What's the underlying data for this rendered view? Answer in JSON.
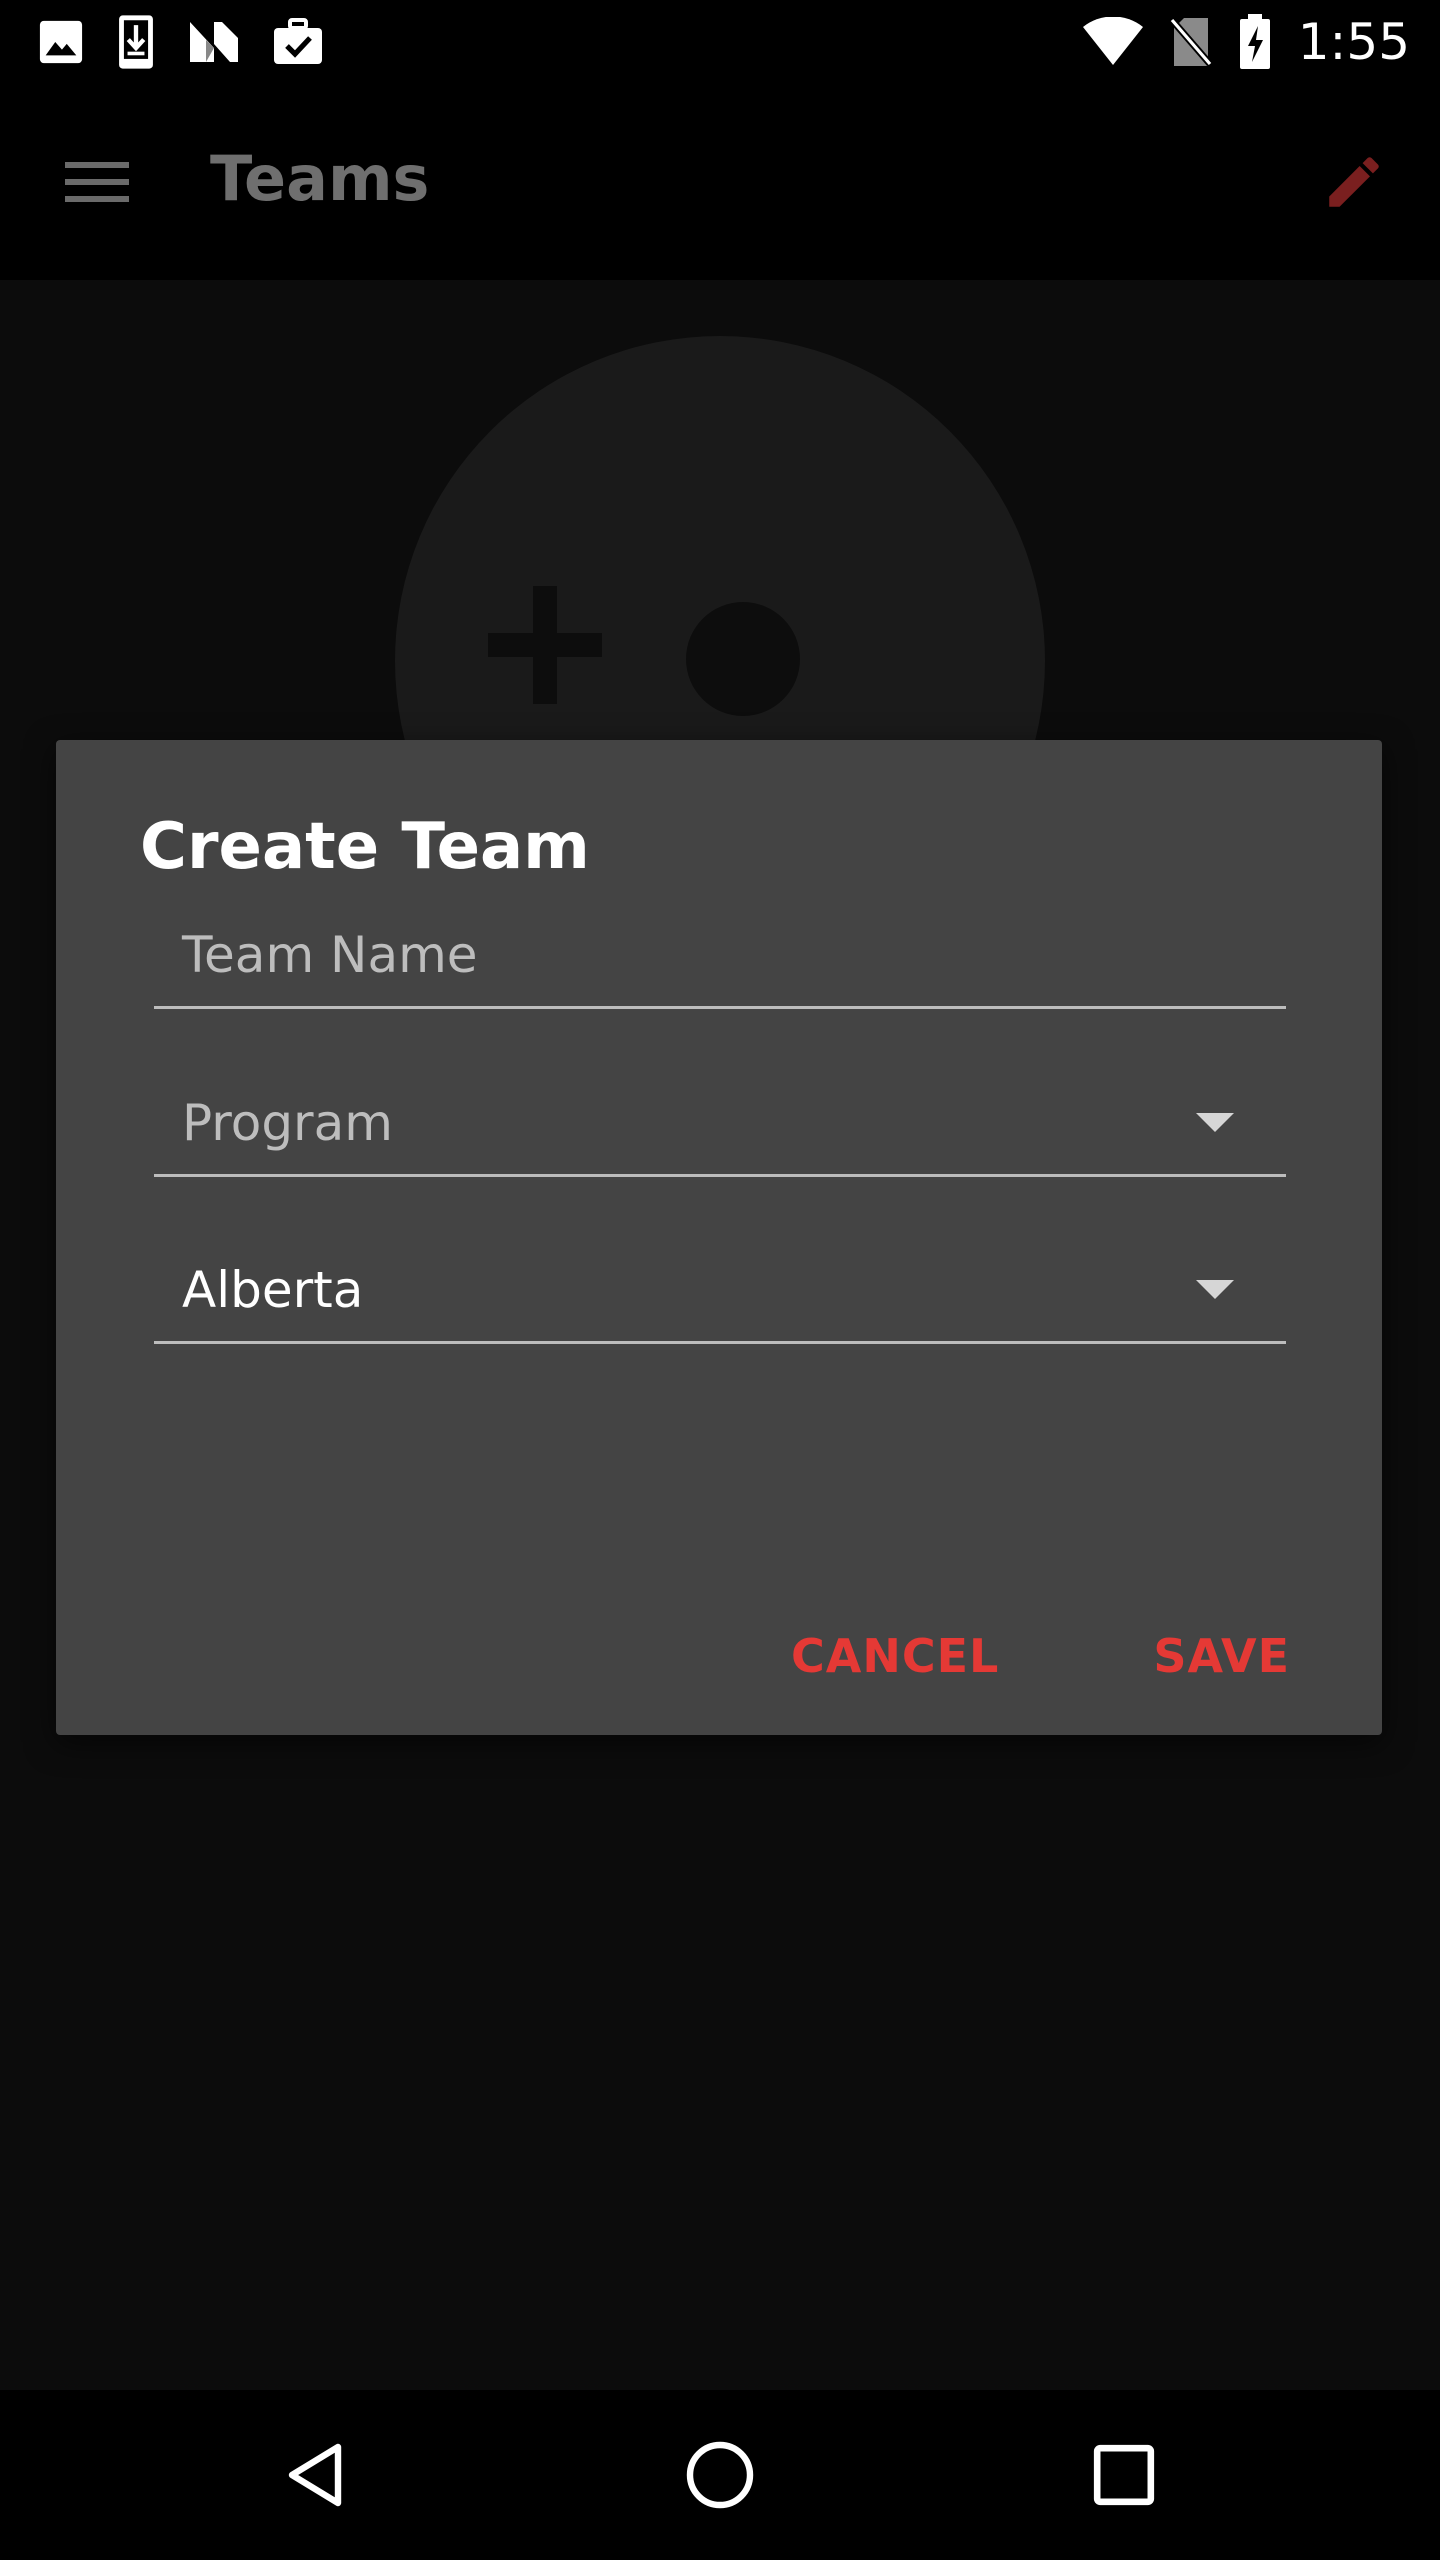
{
  "status_bar": {
    "time": "1:55",
    "left_icons": [
      "image-icon",
      "download-icon",
      "n-logo-icon",
      "briefcase-check-icon"
    ],
    "right_icons": [
      "wifi-icon",
      "no-sim-icon",
      "battery-charging-icon"
    ]
  },
  "app_bar": {
    "title": "Teams",
    "menu_icon": "hamburger-menu-icon",
    "edit_icon": "pencil-icon"
  },
  "dialog": {
    "title": "Create Team",
    "team_name": {
      "placeholder": "Team Name",
      "value": ""
    },
    "program": {
      "placeholder": "Program"
    },
    "province": {
      "value": "Alberta"
    },
    "cancel_label": "CANCEL",
    "save_label": "SAVE"
  },
  "nav_bar": {
    "back_icon": "back-triangle-icon",
    "home_icon": "home-circle-icon",
    "recents_icon": "recents-square-icon"
  },
  "colors": {
    "accent": "#e53935",
    "dialog_bg": "#444444",
    "scrim_bg": "#0c0c0c",
    "edit_icon": "#7a1f1f"
  }
}
